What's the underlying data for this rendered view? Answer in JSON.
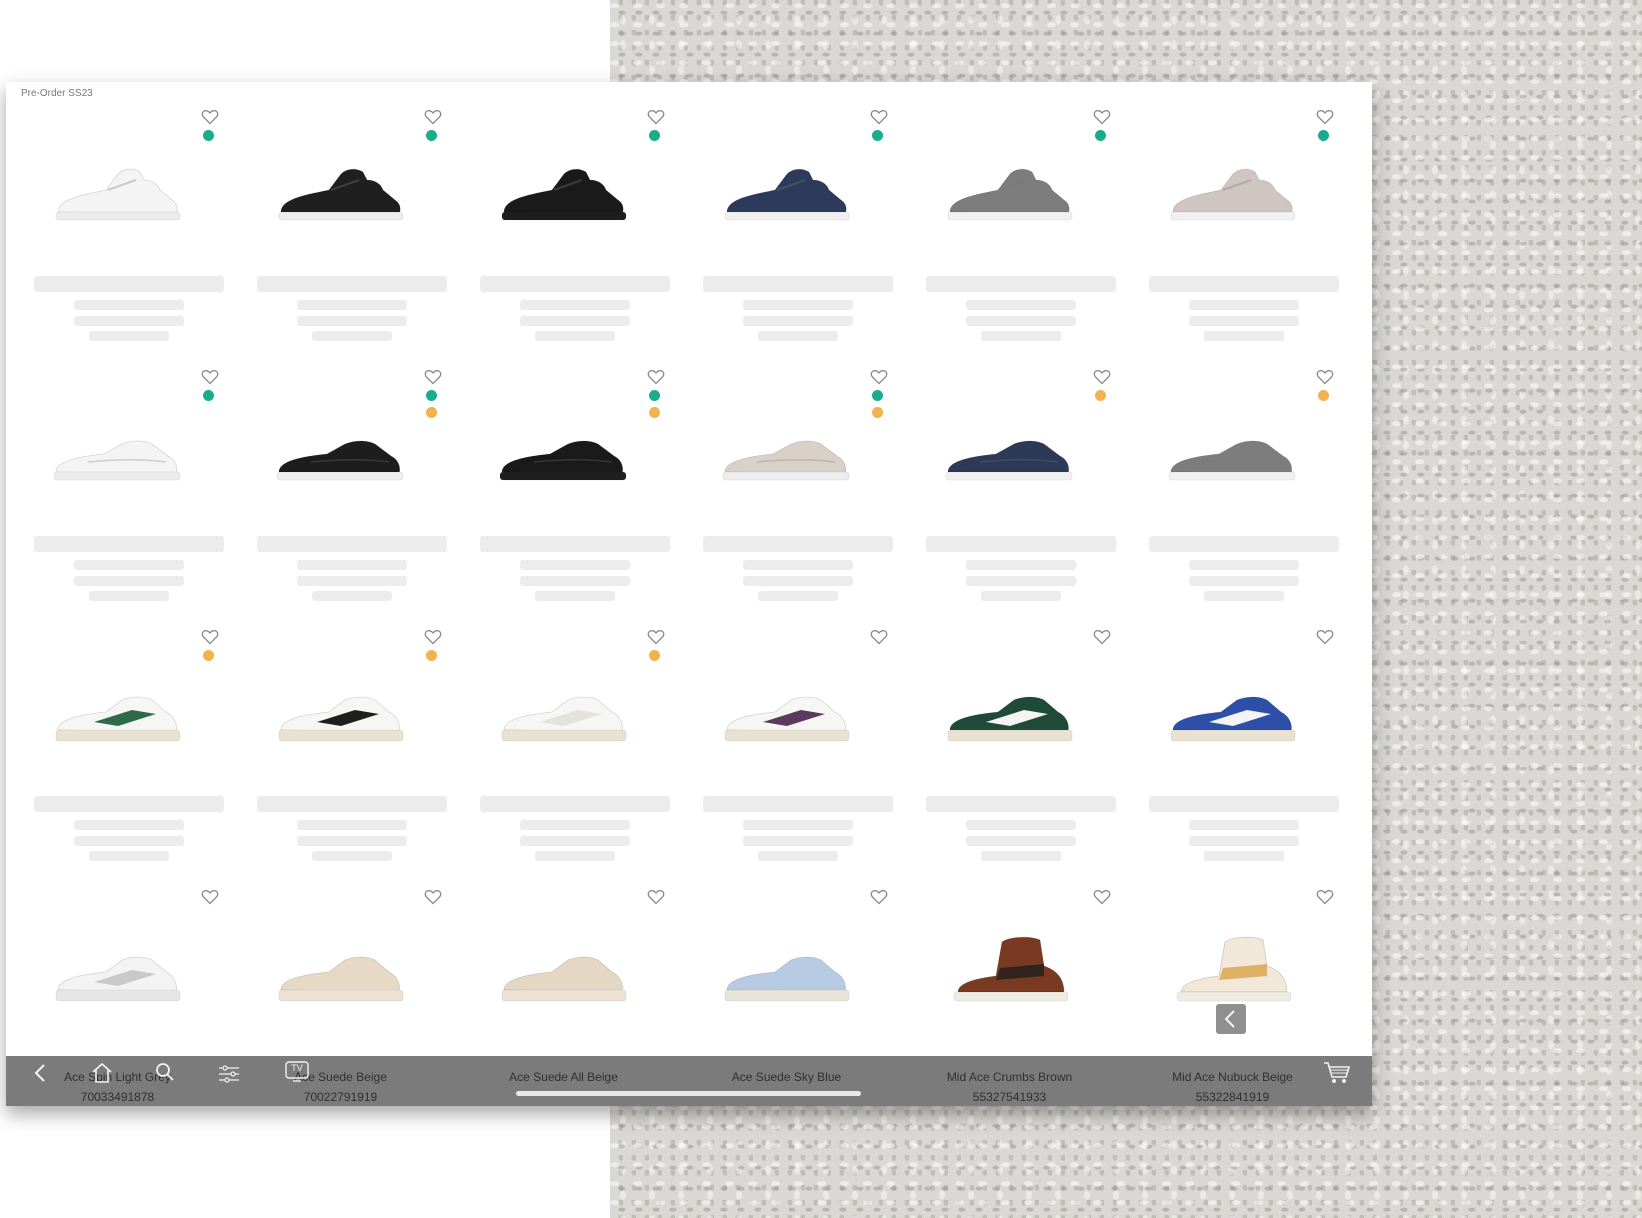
{
  "section": {
    "label": "Pre-Order SS23"
  },
  "colors": {
    "stock_green": "#1aac8c",
    "stock_orange": "#f2b24c",
    "toolbar_bg": "#7b7b7b"
  },
  "icons": [
    "heart-icon",
    "back-chevron-icon",
    "home-icon",
    "search-icon",
    "filter-icon",
    "tv-icon",
    "cart-icon",
    "collapse-chevron-icon"
  ],
  "rows": [
    {
      "products": [
        {
          "shoe": "lowtop",
          "color": "#f4f4f4",
          "sole": "#ececec",
          "dots": [
            "green"
          ]
        },
        {
          "shoe": "lowtop",
          "color": "#1f1f1f",
          "sole": "#ededed",
          "dots": [
            "green"
          ]
        },
        {
          "shoe": "lowtop",
          "color": "#1a1a1a",
          "sole": "#1e1e1e",
          "dots": [
            "green"
          ]
        },
        {
          "shoe": "lowtop",
          "color": "#2d3a5c",
          "sole": "#f1f1f1",
          "dots": [
            "green"
          ]
        },
        {
          "shoe": "lowtop",
          "color": "#7c7c7c",
          "sole": "#f1f1f1",
          "dots": [
            "green"
          ]
        },
        {
          "shoe": "lowtop",
          "color": "#cfc6c2",
          "sole": "#f1f1f1",
          "dots": [
            "green"
          ]
        }
      ]
    },
    {
      "products": [
        {
          "shoe": "mini",
          "color": "#f4f4f4",
          "sole": "#ececec",
          "dots": [
            "green"
          ]
        },
        {
          "shoe": "mini",
          "color": "#1d1d1d",
          "sole": "#f0f0f0",
          "dots": [
            "green",
            "orange"
          ]
        },
        {
          "shoe": "mini",
          "color": "#1a1a1a",
          "sole": "#1f1f1f",
          "dots": [
            "green",
            "orange"
          ]
        },
        {
          "shoe": "mini",
          "color": "#d9d1c8",
          "sole": "#ededed",
          "dots": [
            "green",
            "orange"
          ]
        },
        {
          "shoe": "mini",
          "color": "#2c3a58",
          "sole": "#f1f1f1",
          "dots": [
            "orange"
          ]
        },
        {
          "shoe": "mini",
          "color": "#7d7d7d",
          "sole": "#f1f1f1",
          "dots": [
            "orange"
          ]
        }
      ]
    },
    {
      "products": [
        {
          "shoe": "ace",
          "color": "#f6f6f4",
          "accent": "#2e6b4a",
          "sole": "#e9e2d3",
          "dots": [
            "orange"
          ]
        },
        {
          "shoe": "ace",
          "color": "#f6f6f4",
          "accent": "#1f1f1f",
          "sole": "#e9e2d3",
          "dots": [
            "orange"
          ]
        },
        {
          "shoe": "ace",
          "color": "#f6f6f4",
          "accent": "#e4e2dc",
          "sole": "#e9e2d3",
          "dots": [
            "orange"
          ]
        },
        {
          "shoe": "ace",
          "color": "#f6f6f4",
          "accent": "#5a3a5e",
          "sole": "#e9e2d3",
          "dots": []
        },
        {
          "shoe": "ace",
          "color": "#1f4a3a",
          "accent": "#f4f4f4",
          "sole": "#e9e2d3",
          "dots": []
        },
        {
          "shoe": "ace",
          "color": "#2d4fa8",
          "accent": "#f4f4f4",
          "sole": "#e9e2d3",
          "dots": []
        }
      ]
    },
    {
      "products": [
        {
          "shoe": "ace",
          "color": "#f3f3f3",
          "accent": "#c9c9c9",
          "sole": "#e6e6e6",
          "dots": []
        },
        {
          "shoe": "ace",
          "color": "#e6d9c6",
          "accent": "#e6d9c6",
          "sole": "#ece3d6",
          "dots": []
        },
        {
          "shoe": "ace",
          "color": "#e4d8c4",
          "accent": "#e4d8c4",
          "sole": "#ece3d6",
          "dots": []
        },
        {
          "shoe": "ace",
          "color": "#b7cbe4",
          "accent": "#b7cbe4",
          "sole": "#e9e4d8",
          "dots": []
        },
        {
          "shoe": "mid",
          "color": "#7a3a22",
          "accent": "#1f1f1f",
          "sole": "#f0ece4",
          "dots": []
        },
        {
          "shoe": "mid",
          "color": "#f1e8da",
          "accent": "#d9a24a",
          "sole": "#f0ece4",
          "dots": []
        }
      ]
    }
  ],
  "bottom_row": [
    {
      "name": "Ace Spin Light Grey",
      "code": "70033491878"
    },
    {
      "name": "Ace Suede Beige",
      "code": "70022791919"
    },
    {
      "name": "Ace Suede All Beige",
      "code": ""
    },
    {
      "name": "Ace Suede Sky Blue",
      "code": ""
    },
    {
      "name": "Mid Ace Crumbs Brown",
      "code": "55327541933"
    },
    {
      "name": "Mid Ace Nubuck Beige",
      "code": "55322841919"
    }
  ],
  "toolbar": {
    "tv_label": "TV"
  }
}
